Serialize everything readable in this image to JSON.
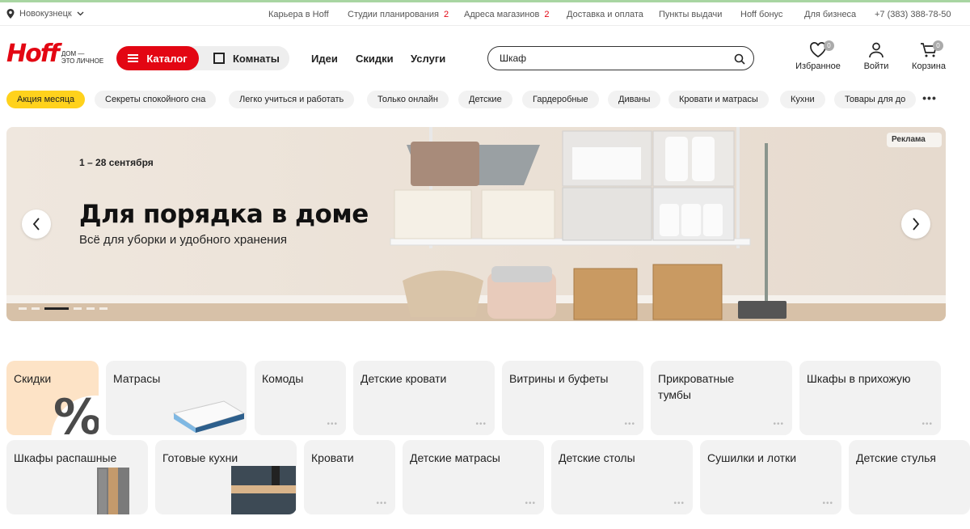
{
  "city": {
    "name": "Новокузнецк"
  },
  "util_links": [
    {
      "label": "Карьера в Hoff",
      "count": ""
    },
    {
      "label": "Студии планирования",
      "count": "2"
    },
    {
      "label": "Адреса магазинов",
      "count": "2"
    },
    {
      "label": "Доставка и оплата",
      "count": ""
    },
    {
      "label": "Пункты выдачи",
      "count": ""
    },
    {
      "label": "Hoff бонус",
      "count": ""
    },
    {
      "label": "Для бизнеса",
      "count": ""
    },
    {
      "label": "+7 (383) 388-78-50",
      "count": ""
    }
  ],
  "logo": {
    "brand": "Hoff",
    "tagline_1": "ДОМ —",
    "tagline_2": "ЭТО ЛИЧНОЕ"
  },
  "header": {
    "catalog_label": "Каталог",
    "rooms_label": "Комнаты",
    "nav": [
      "Идеи",
      "Скидки",
      "Услуги"
    ],
    "search_value": "Шкаф",
    "favorites_label": "Избранное",
    "favorites_count": "0",
    "login_label": "Войти",
    "cart_label": "Корзина",
    "cart_count": "0"
  },
  "chips": [
    "Акция месяца",
    "Секреты спокойного сна",
    "Легко учиться и работать",
    "Только онлайн",
    "Детские",
    "Гардеробные",
    "Диваны",
    "Кровати и матрасы",
    "Кухни",
    "Товары для до"
  ],
  "chips_more": "•••",
  "banner": {
    "date": "1 – 28 сентября",
    "title": "Для порядка в доме",
    "subtitle": "Всё для уборки и удобного хранения",
    "ad_label": "Реклама",
    "slides_total": 6,
    "active_slide": 2
  },
  "categories_row1": [
    "Скидки",
    "Матрасы",
    "Комоды",
    "Детские кровати",
    "Витрины и буфеты",
    "Прикроватные тумбы",
    "Шкафы в прихожую"
  ],
  "categories_row2": [
    "Шкафы распашные",
    "Готовые кухни",
    "Кровати",
    "Детские матрасы",
    "Детские столы",
    "Сушилки и лотки",
    "Детские стулья"
  ],
  "colors": {
    "accent": "#e30613",
    "chip_active": "#ffd21c",
    "tile": "#f2f2f2",
    "sale_tile": "#fde3c6"
  }
}
